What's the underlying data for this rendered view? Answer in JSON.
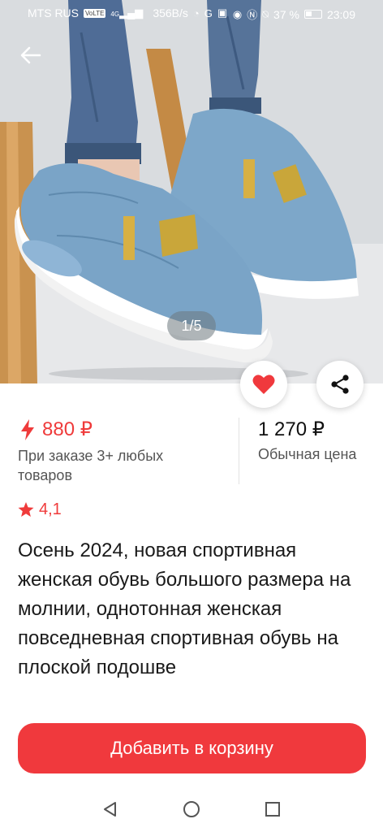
{
  "status_bar": {
    "carrier": "MTS RUS",
    "volte": "VoLTE",
    "network": "4G",
    "speed": "356B/s",
    "battery": "37 %",
    "time": "23:09",
    "icons": [
      "signal-icon",
      "o-app-icon",
      "g-app-icon",
      "n-app-icon",
      "eye-icon",
      "nfc-icon",
      "mute-icon",
      "battery-icon"
    ]
  },
  "gallery": {
    "counter": "1/5"
  },
  "price": {
    "promo": "880 ₽",
    "promo_note": "При заказе 3+ любых товаров",
    "regular": "1 270 ₽",
    "regular_note": "Обычная цена"
  },
  "rating": {
    "value": "4,1"
  },
  "product": {
    "title": "Осень 2024, новая спортивная женская обувь большого размера на молнии, однотонная женская повседневная спортивная обувь на плоской подошве"
  },
  "cta": {
    "label": "Добавить в корзину"
  },
  "colors": {
    "accent": "#f0393d",
    "text": "#1a1a1a",
    "muted": "#555555"
  }
}
